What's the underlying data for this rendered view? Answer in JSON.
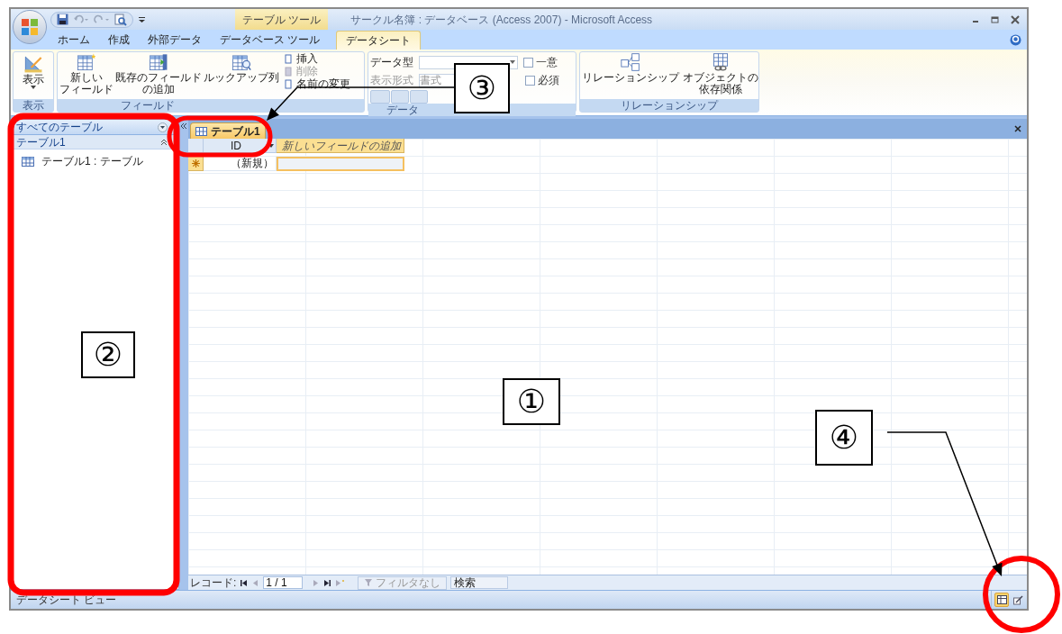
{
  "window": {
    "title": "サークル名簿 : データベース (Access 2007) - Microsoft Access",
    "contextual_tab": "テーブル ツール"
  },
  "ribbon_tabs": [
    {
      "label": "ホーム",
      "selected": false
    },
    {
      "label": "作成",
      "selected": false
    },
    {
      "label": "外部データ",
      "selected": false
    },
    {
      "label": "データベース ツール",
      "selected": false
    },
    {
      "label": "データシート",
      "selected": true
    }
  ],
  "ribbon": {
    "view": {
      "button": "表示",
      "group_label": "表示"
    },
    "fields": {
      "large_buttons": [
        {
          "lines": [
            "新しい",
            "フィールド"
          ]
        },
        {
          "lines": [
            "既存のフィールド",
            "の追加"
          ]
        },
        {
          "lines": [
            "ルックアップ列"
          ]
        }
      ],
      "small_buttons": [
        {
          "label": "挿入",
          "disabled": false
        },
        {
          "label": "削除",
          "disabled": true
        },
        {
          "label": "名前の変更",
          "disabled": false
        }
      ],
      "group_label": "フィールド"
    },
    "datatype": {
      "type_label": "データ型",
      "format_label": "表示形式",
      "format_value": "書式",
      "checkboxes": [
        {
          "label": "一意",
          "checked": false
        },
        {
          "label": "必須",
          "checked": false
        }
      ],
      "group_label": "データ"
    },
    "relationships": {
      "buttons": [
        {
          "lines": [
            "リレーションシップ"
          ]
        },
        {
          "lines": [
            "オブジェクトの",
            "依存関係"
          ]
        }
      ],
      "group_label": "リレーションシップ"
    }
  },
  "nav_pane": {
    "header": "すべてのテーブル",
    "group": "テーブル1",
    "items": [
      "テーブル1 : テーブル"
    ]
  },
  "document_tabs": [
    {
      "label": "テーブル1",
      "selected": true
    }
  ],
  "datasheet": {
    "columns": [
      {
        "label": "ID",
        "kind": "field"
      },
      {
        "label": "新しいフィールドの追加",
        "kind": "add"
      }
    ],
    "new_row": [
      "（新規）"
    ]
  },
  "record_nav": {
    "label": "レコード:",
    "position": "1 / 1",
    "filter": "フィルタなし",
    "search": "検索"
  },
  "status_bar": {
    "text": "データシート ビュー",
    "views": [
      {
        "selected": true
      },
      {
        "selected": false
      }
    ]
  },
  "annotations": [
    {
      "label": "①"
    },
    {
      "label": "②"
    },
    {
      "label": "③"
    },
    {
      "label": "④"
    }
  ]
}
